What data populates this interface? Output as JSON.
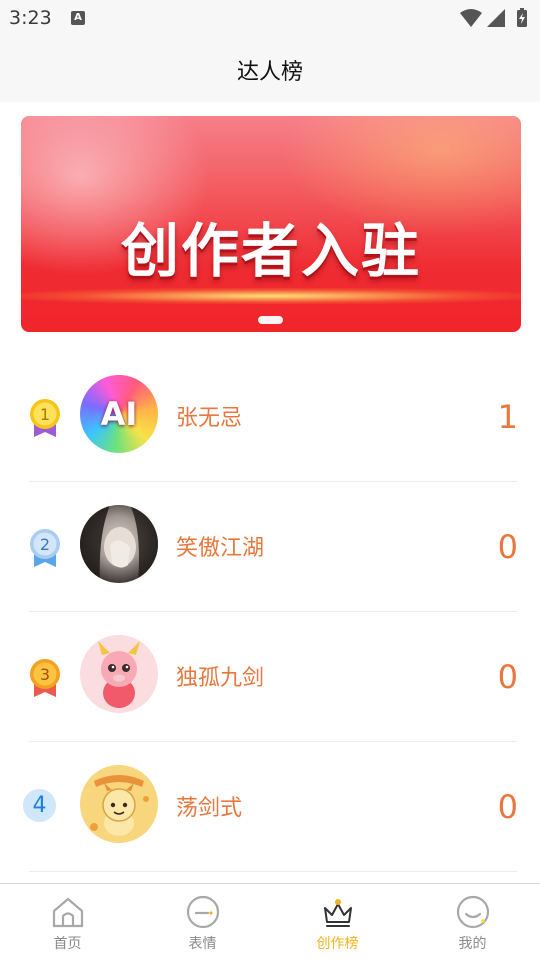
{
  "status_bar": {
    "time": "3:23",
    "notification_icon": "A"
  },
  "header": {
    "title": "达人榜"
  },
  "banner": {
    "title": "创作者入驻",
    "carousel_count": 1
  },
  "ranking": [
    {
      "rank": "1",
      "name": "张无忌",
      "score": "1",
      "avatar": "ai-colorful-avatar",
      "badge": "gold-medal-icon"
    },
    {
      "rank": "2",
      "name": "笑傲江湖",
      "score": "0",
      "avatar": "girl-photo-avatar",
      "badge": "silver-medal-icon"
    },
    {
      "rank": "3",
      "name": "独孤九剑",
      "score": "0",
      "avatar": "pink-dragon-avatar",
      "badge": "bronze-medal-icon"
    },
    {
      "rank": "4",
      "name": "荡剑式",
      "score": "0",
      "avatar": "gold-dragon-avatar",
      "badge": "rank-number-badge"
    }
  ],
  "avatar_texts": {
    "ai": "AI"
  },
  "bottom_nav": [
    {
      "label": "首页",
      "icon": "home-icon",
      "active": false
    },
    {
      "label": "表情",
      "icon": "emoji-chat-icon",
      "active": false
    },
    {
      "label": "创作榜",
      "icon": "crown-icon",
      "active": true
    },
    {
      "label": "我的",
      "icon": "smile-profile-icon",
      "active": false
    }
  ],
  "colors": {
    "accent": "#e8773e",
    "nav_active": "#f5b21d",
    "nav_inactive": "#8a8a8a",
    "banner_red": "#ef2c33",
    "rank_badge_blue": "#1d7fe0"
  }
}
